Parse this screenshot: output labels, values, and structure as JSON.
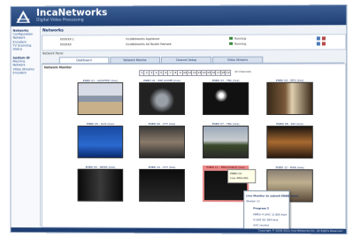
{
  "app": {
    "name": "IncaNetworks",
    "subtitle": "Digital Video Processing"
  },
  "nav": {
    "groups": [
      {
        "heading": "Networks",
        "items": [
          "Configuration",
          "Network",
          "Encoders",
          "TV Scanning",
          "Status"
        ]
      },
      {
        "heading": "System ID",
        "items": [
          "Machine",
          "Network",
          "Video Streams",
          "Encoders"
        ]
      }
    ]
  },
  "main": {
    "section_title": "Networks",
    "info": {
      "rows": [
        {
          "col1": "XXXXXX-1",
          "col2": "IncaNetworks Appliance",
          "status": "Running"
        },
        {
          "col1": "XXXXXX",
          "col2": "IncaNetworks Ad Router Remote",
          "status": "Running"
        }
      ]
    },
    "subhead": "Network Panel",
    "tabs": [
      "Dashboard",
      "Network Monitor",
      "Channel Setup",
      "Video Streams"
    ],
    "content_label": "Network Monitor",
    "pager": {
      "pages": [
        "1",
        "2",
        "3",
        "4",
        "5",
        "6",
        "7",
        "8",
        "9",
        "10",
        "11",
        "12",
        "13",
        "14",
        "15",
        "16",
        "17",
        "18",
        "19"
      ],
      "info": "All Channels"
    },
    "cameras": [
      {
        "caption": "ENBD 01 - ADOPTED (live)",
        "scene": "classroom"
      },
      {
        "caption": "ENBD 02 - PRE SCOPE (live)",
        "scene": "dark-room"
      },
      {
        "caption": "ENBD 03 - TBA (live)",
        "scene": "night"
      },
      {
        "caption": "ENBD 04 - MTV (live)",
        "scene": "studio"
      },
      {
        "caption": "ENBD 05 - KLIS (live)",
        "scene": "blue"
      },
      {
        "caption": "ENBD 06 - CTV (live)",
        "scene": "people"
      },
      {
        "caption": "ENBD 07 - TBA (live)",
        "scene": "outdoor"
      },
      {
        "caption": "ENBD 08 - ROI (live)",
        "scene": "sunset"
      },
      {
        "caption": "ENBD 09 - NEWS (live)",
        "scene": "news"
      },
      {
        "caption": "ENBD 10 - CTV (live)",
        "scene": "dark"
      },
      {
        "caption": "ENBD 11 - PERCHANCE (live)",
        "scene": "dark2"
      },
      {
        "caption": "ENBD 12 - MAN (live)",
        "scene": "portrait"
      }
    ],
    "tooltip": {
      "line1": "ENBD 02",
      "line2": "Live 480x360"
    },
    "popup": {
      "title": "Live Monitor to submit ENBD (live)",
      "line2": "Stream 11",
      "section": "Program 2",
      "items": [
        "MPEG-4 (AVC 1) 800 kb/s",
        "H.264 SD 384 kb/s",
        "AAC (audio)",
        "AC-3 (audio)"
      ]
    }
  },
  "footer": {
    "text": "Copyright © 2008-2011 Inca Networks Inc. All Rights Reserved"
  }
}
